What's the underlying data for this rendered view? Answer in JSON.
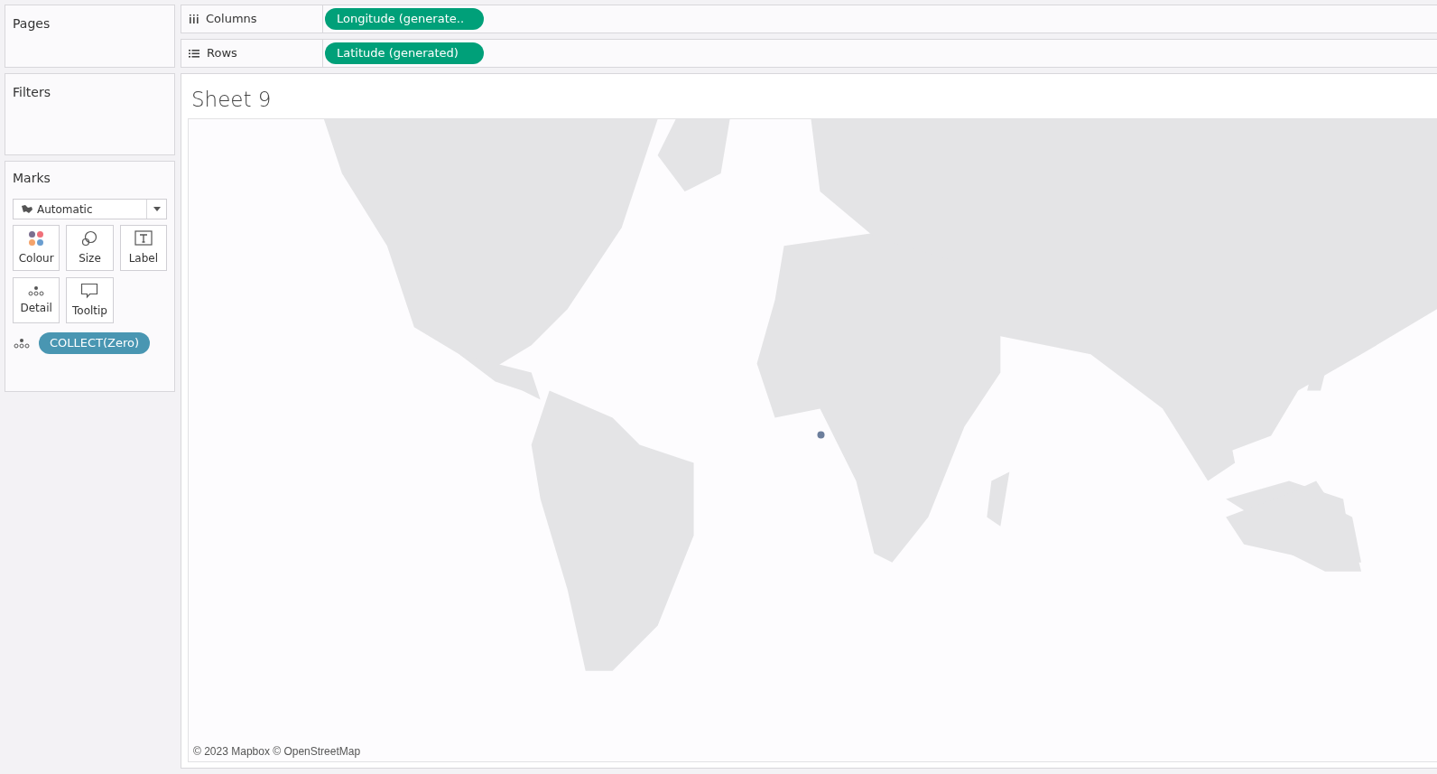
{
  "side_panels": {
    "pages": {
      "title": "Pages"
    },
    "filters": {
      "title": "Filters"
    }
  },
  "marks": {
    "title": "Marks",
    "mark_type": "Automatic",
    "buttons": [
      {
        "label": "Colour",
        "kind": "colour"
      },
      {
        "label": "Size",
        "kind": "size"
      },
      {
        "label": "Label",
        "kind": "label"
      },
      {
        "label": "Detail",
        "kind": "detail"
      },
      {
        "label": "Tooltip",
        "kind": "tooltip"
      }
    ],
    "fields": [
      {
        "label": "COLLECT(Zero)",
        "kind": "discrete",
        "on_detail": true
      }
    ]
  },
  "shelves": [
    {
      "label": "Columns",
      "kind": "columns",
      "pills": [
        {
          "label": "Longitude (generate..",
          "kind": "continuous"
        }
      ]
    },
    {
      "label": "Rows",
      "kind": "rows",
      "pills": [
        {
          "label": "Latitude (generated)",
          "kind": "continuous"
        }
      ]
    }
  ],
  "sheet": {
    "title": "Sheet 9",
    "attribution": "© 2023 Mapbox © OpenStreetMap"
  }
}
